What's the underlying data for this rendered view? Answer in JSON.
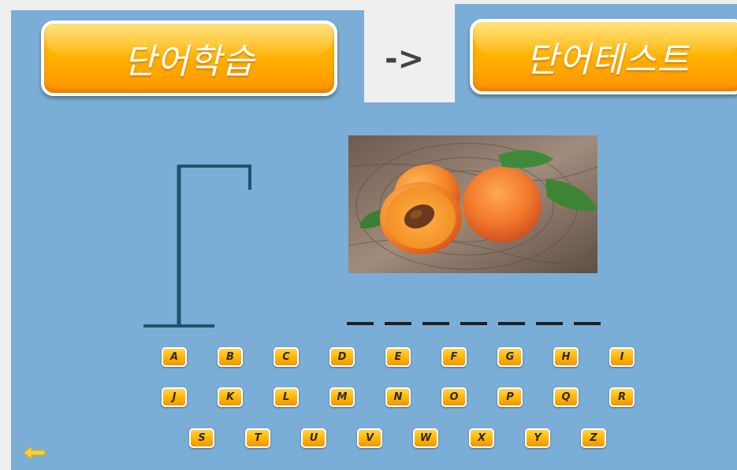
{
  "buttons": {
    "learn_label": "단어학습",
    "test_label": "단어테스트"
  },
  "arrow_text": "->",
  "word_length": 7,
  "keyboard": {
    "row1": [
      "A",
      "B",
      "C",
      "D",
      "E",
      "F",
      "G",
      "H",
      "I"
    ],
    "row2": [
      "J",
      "K",
      "L",
      "M",
      "N",
      "O",
      "P",
      "Q",
      "R"
    ],
    "row3": [
      "S",
      "T",
      "U",
      "V",
      "W",
      "X",
      "Y",
      "Z"
    ]
  },
  "colors": {
    "background": "#7aaed6",
    "button_orange": "#ffb300",
    "gallows": "#1d5470",
    "back_arrow": "#f5d23a"
  },
  "icons": {
    "back": "back-arrow-icon"
  }
}
